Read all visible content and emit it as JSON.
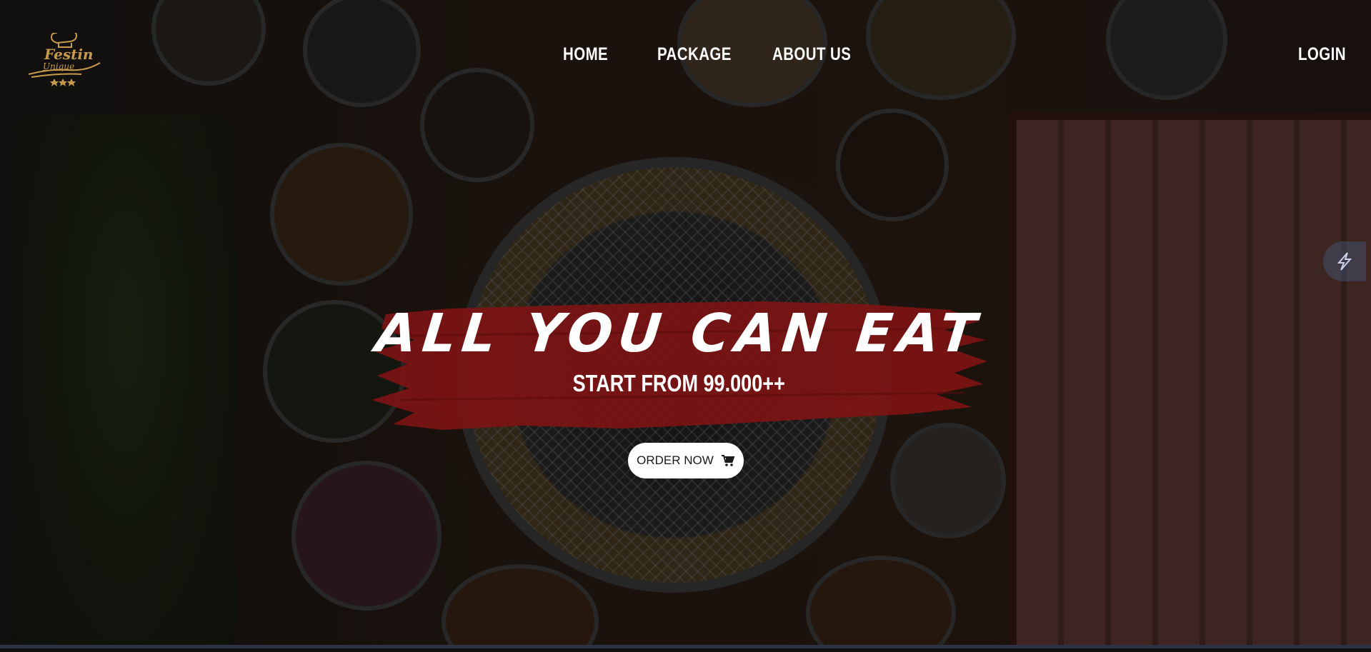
{
  "brand": {
    "logo_line1": "Festin",
    "logo_line2": "Unique",
    "logo_icon": "chef-hat-icon",
    "accent_color": "#c69a4a"
  },
  "nav": {
    "items": [
      {
        "label": "HOME"
      },
      {
        "label": "PACKAGE"
      },
      {
        "label": "ABOUT US"
      }
    ],
    "login_label": "LOGIN"
  },
  "hero": {
    "headline": "ALL YOU CAN EAT",
    "subline": "START FROM 99.000++",
    "cta_label": "ORDER NOW",
    "cta_icon": "cart-icon",
    "brush_color": "#7d1414",
    "side_icon": "lightning-icon"
  }
}
